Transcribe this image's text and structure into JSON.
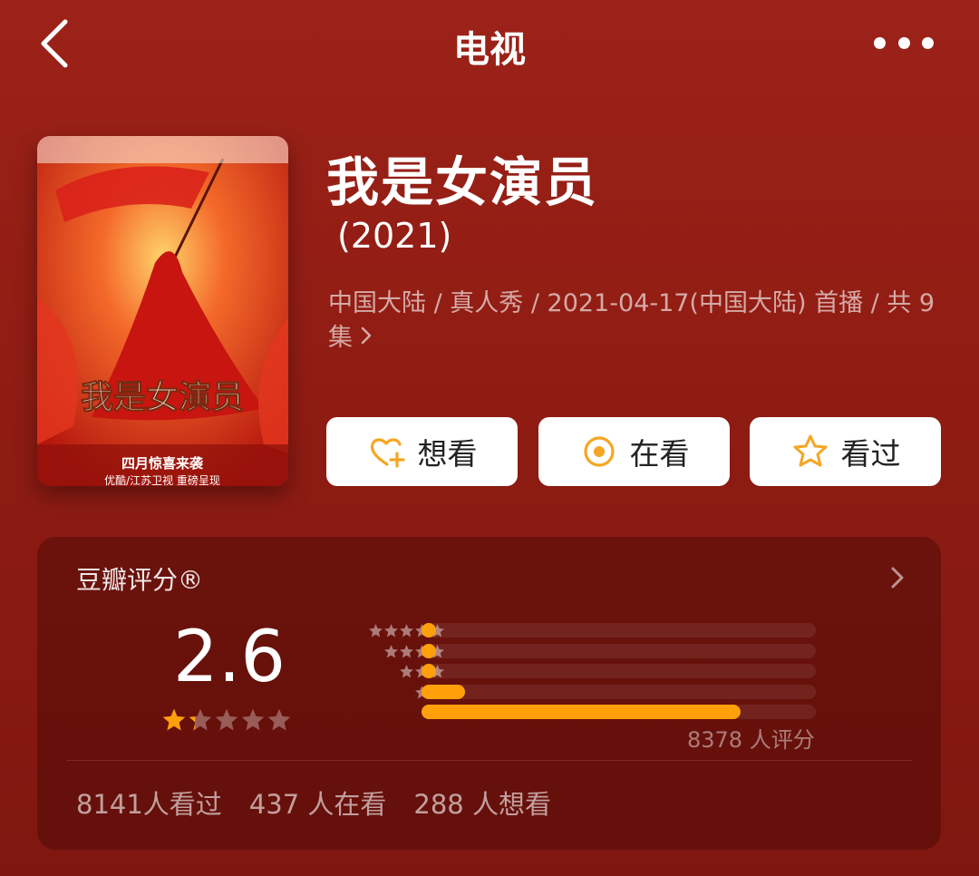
{
  "nav": {
    "title": "电视",
    "back_icon": "chevron-left-icon",
    "more_icon": "more-dots-icon"
  },
  "show": {
    "title": "我是女演员",
    "year": "(2021)",
    "meta": "中国大陆 / 真人秀 / 2021-04-17(中国大陆) 首播 / 共 9 集",
    "poster": {
      "logo_text": "我是女演员",
      "tagline": "四月惊喜来袭",
      "platforms": "优酷/江苏卫视 重磅呈现"
    }
  },
  "actions": [
    {
      "label": "想看",
      "icon": "heart-plus-icon"
    },
    {
      "label": "在看",
      "icon": "circle-dot-icon"
    },
    {
      "label": "看过",
      "icon": "star-outline-icon"
    }
  ],
  "rating": {
    "title": "豆瓣评分®",
    "score": "2.6",
    "stars_filled": 1.3,
    "stars_total": 5,
    "distribution": [
      {
        "stars": 5,
        "fraction": 0.03
      },
      {
        "stars": 4,
        "fraction": 0.03
      },
      {
        "stars": 3,
        "fraction": 0.03
      },
      {
        "stars": 2,
        "fraction": 0.11
      },
      {
        "stars": 1,
        "fraction": 0.81
      }
    ],
    "count_text": "8378 人评分",
    "stats": {
      "watched": "8141人看过",
      "watching": "437 人在看",
      "wish": "288 人想看"
    }
  },
  "colors": {
    "background": "#9c2218",
    "accent_orange": "#ff9f0a",
    "action_icon": "#f5a623",
    "card_bg": "#5e1009"
  }
}
